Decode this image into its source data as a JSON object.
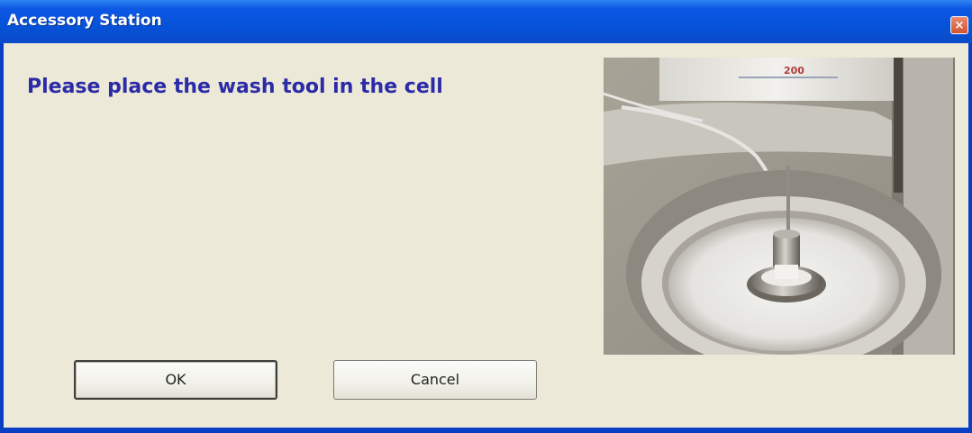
{
  "window": {
    "title": "Accessory Station",
    "close_label": "×"
  },
  "dialog": {
    "message": "Please place the wash tool in the cell",
    "image_label_text": "200"
  },
  "buttons": {
    "ok_label": "OK",
    "cancel_label": "Cancel"
  },
  "colors": {
    "titlebar": "#0A4BC9",
    "dialog_background": "#ECE9D8",
    "message_text": "#2B2BA8",
    "close_button": "#D2532F"
  }
}
